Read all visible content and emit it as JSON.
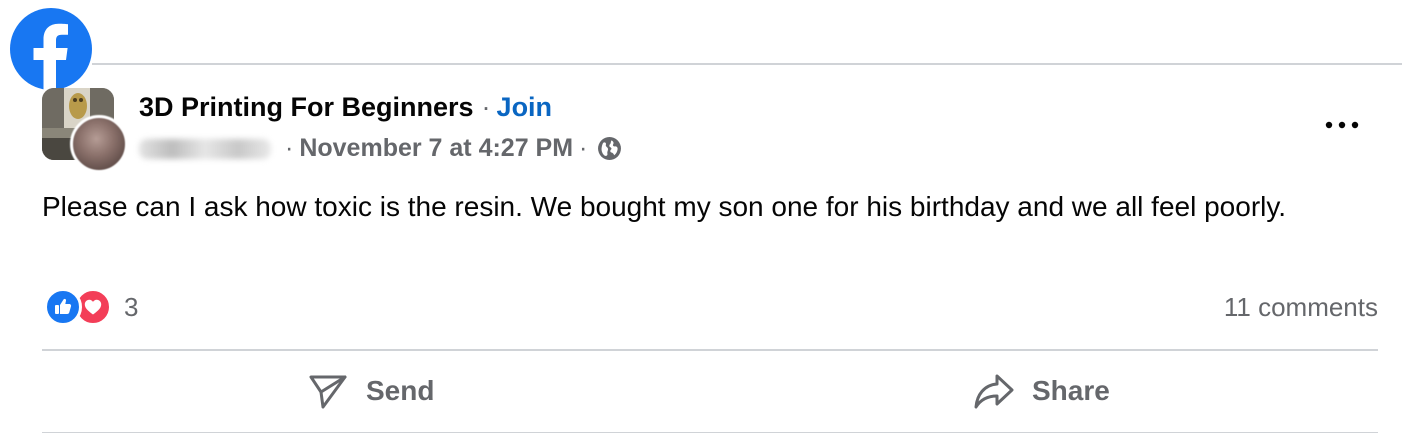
{
  "app": {
    "logo_icon": "facebook-logo-icon",
    "brand_color": "#1877f2"
  },
  "post": {
    "group_name": "3D Printing For Beginners",
    "separator": "·",
    "join_label": "Join",
    "timestamp": "November 7 at 4:27 PM",
    "privacy_icon": "globe-icon",
    "more_icon": "more-options-icon",
    "text": "Please can I ask how toxic is the resin. We bought my son one for his birthday and we all feel poorly."
  },
  "engagement": {
    "reaction_icons": [
      "like-icon",
      "love-icon"
    ],
    "reaction_count": "3",
    "comments_label": "11 comments"
  },
  "actions": {
    "send_label": "Send",
    "share_label": "Share"
  },
  "colors": {
    "link": "#0a66c2",
    "secondary_text": "#65676b",
    "like": "#1877f2",
    "love": "#f33e58"
  }
}
